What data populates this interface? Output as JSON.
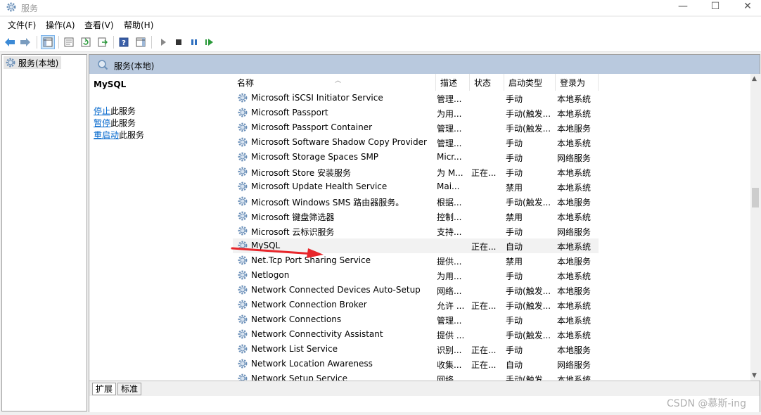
{
  "window": {
    "title": "服务",
    "title_icon": "gear-icon"
  },
  "window_controls": {
    "minimize": "—",
    "maximize": "☐",
    "close": "✕"
  },
  "menu": [
    {
      "label": "文件(F)"
    },
    {
      "label": "操作(A)"
    },
    {
      "label": "查看(V)"
    },
    {
      "label": "帮助(H)"
    }
  ],
  "toolbar": {
    "icons": [
      "back-arrow-icon",
      "forward-arrow-icon",
      "show-console-tree-icon",
      "properties-icon",
      "refresh-icon",
      "export-list-icon",
      "help-icon",
      "show-action-pane-icon",
      "start-service-icon",
      "stop-service-icon",
      "pause-service-icon",
      "restart-service-icon"
    ]
  },
  "tree": {
    "item": "服务(本地)"
  },
  "pane_header": {
    "title": "服务(本地)"
  },
  "details": {
    "service_name": "MySQL",
    "actions": [
      {
        "link": "停止",
        "rest": "此服务"
      },
      {
        "link": "暂停",
        "rest": "此服务"
      },
      {
        "link": "重启动",
        "rest": "此服务"
      }
    ]
  },
  "columns": {
    "name": "名称",
    "description": "描述",
    "status": "状态",
    "startup": "启动类型",
    "logon": "登录为"
  },
  "services": [
    {
      "name": "Microsoft iSCSI Initiator Service",
      "description": "管理...",
      "status": "",
      "startup": "手动",
      "logon": "本地系统"
    },
    {
      "name": "Microsoft Passport",
      "description": "为用...",
      "status": "",
      "startup": "手动(触发...",
      "logon": "本地系统"
    },
    {
      "name": "Microsoft Passport Container",
      "description": "管理...",
      "status": "",
      "startup": "手动(触发...",
      "logon": "本地服务"
    },
    {
      "name": "Microsoft Software Shadow Copy Provider",
      "description": "管理...",
      "status": "",
      "startup": "手动",
      "logon": "本地系统"
    },
    {
      "name": "Microsoft Storage Spaces SMP",
      "description": "Micr...",
      "status": "",
      "startup": "手动",
      "logon": "网络服务"
    },
    {
      "name": "Microsoft Store 安装服务",
      "description": "为 M...",
      "status": "正在...",
      "startup": "手动",
      "logon": "本地系统"
    },
    {
      "name": "Microsoft Update Health Service",
      "description": "Mai...",
      "status": "",
      "startup": "禁用",
      "logon": "本地系统"
    },
    {
      "name": "Microsoft Windows SMS 路由器服务。",
      "description": "根据...",
      "status": "",
      "startup": "手动(触发...",
      "logon": "本地服务"
    },
    {
      "name": "Microsoft 键盘筛选器",
      "description": "控制...",
      "status": "",
      "startup": "禁用",
      "logon": "本地系统"
    },
    {
      "name": "Microsoft 云标识服务",
      "description": "支持...",
      "status": "",
      "startup": "手动",
      "logon": "网络服务"
    },
    {
      "name": "MySQL",
      "description": "",
      "status": "正在...",
      "startup": "自动",
      "logon": "本地系统"
    },
    {
      "name": "Net.Tcp Port Sharing Service",
      "description": "提供...",
      "status": "",
      "startup": "禁用",
      "logon": "本地服务"
    },
    {
      "name": "Netlogon",
      "description": "为用...",
      "status": "",
      "startup": "手动",
      "logon": "本地系统"
    },
    {
      "name": "Network Connected Devices Auto-Setup",
      "description": "网络...",
      "status": "",
      "startup": "手动(触发...",
      "logon": "本地服务"
    },
    {
      "name": "Network Connection Broker",
      "description": "允许 ...",
      "status": "正在...",
      "startup": "手动(触发...",
      "logon": "本地系统"
    },
    {
      "name": "Network Connections",
      "description": "管理...",
      "status": "",
      "startup": "手动",
      "logon": "本地系统"
    },
    {
      "name": "Network Connectivity Assistant",
      "description": "提供 ...",
      "status": "",
      "startup": "手动(触发...",
      "logon": "本地系统"
    },
    {
      "name": "Network List Service",
      "description": "识别...",
      "status": "正在...",
      "startup": "手动",
      "logon": "本地服务"
    },
    {
      "name": "Network Location Awareness",
      "description": "收集...",
      "status": "正在...",
      "startup": "自动",
      "logon": "网络服务"
    },
    {
      "name": "Network Setup Service",
      "description": "网络...",
      "status": "",
      "startup": "手动(触发...",
      "logon": "本地系统"
    }
  ],
  "tabs": [
    {
      "label": "扩展"
    },
    {
      "label": "标准"
    }
  ],
  "watermark": "CSDN @慕斯-ing",
  "colors": {
    "pane_header": "#b9c9de",
    "link": "#0066cc",
    "annotation_arrow": "#e8262b"
  }
}
